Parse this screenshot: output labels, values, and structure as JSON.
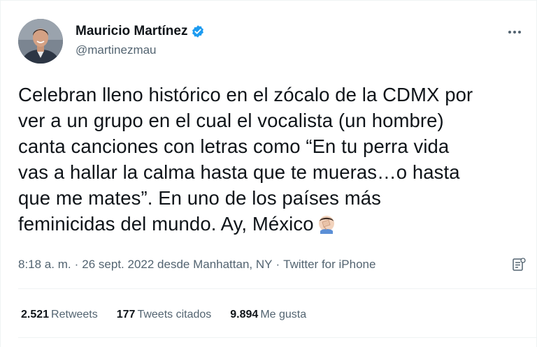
{
  "tweet": {
    "author": {
      "display_name": "Mauricio Martínez",
      "handle": "@martinezmau",
      "verified": true
    },
    "text_lines": [
      "Celebran lleno histórico en el zócalo de la CDMX por",
      "ver a un grupo en el cual el vocalista (un hombre)",
      "canta canciones con letras como “En tu perra vida",
      "vas a hallar la calma hasta que te mueras…o hasta",
      "que me mates”. En uno de los países más",
      "feminicidas del mundo. Ay, México"
    ],
    "emoji": "facepalm-emoji",
    "time": "8:18 a. m.",
    "date_location": "26 sept. 2022 desde Manhattan, NY",
    "source": "Twitter for iPhone",
    "separator": "·",
    "stats": {
      "retweets": {
        "count": "2.521",
        "label": "Retweets"
      },
      "quotes": {
        "count": "177",
        "label": "Tweets citados"
      },
      "likes": {
        "count": "9.894",
        "label": "Me gusta"
      }
    }
  },
  "colors": {
    "text": "#0f1419",
    "secondary": "#536471",
    "verified_blue": "#1d9bf0",
    "divider": "#eff3f4"
  },
  "icons": {
    "more": "more-horizontal-icon",
    "verified": "verified-badge-icon",
    "analytics": "analytics-icon"
  }
}
